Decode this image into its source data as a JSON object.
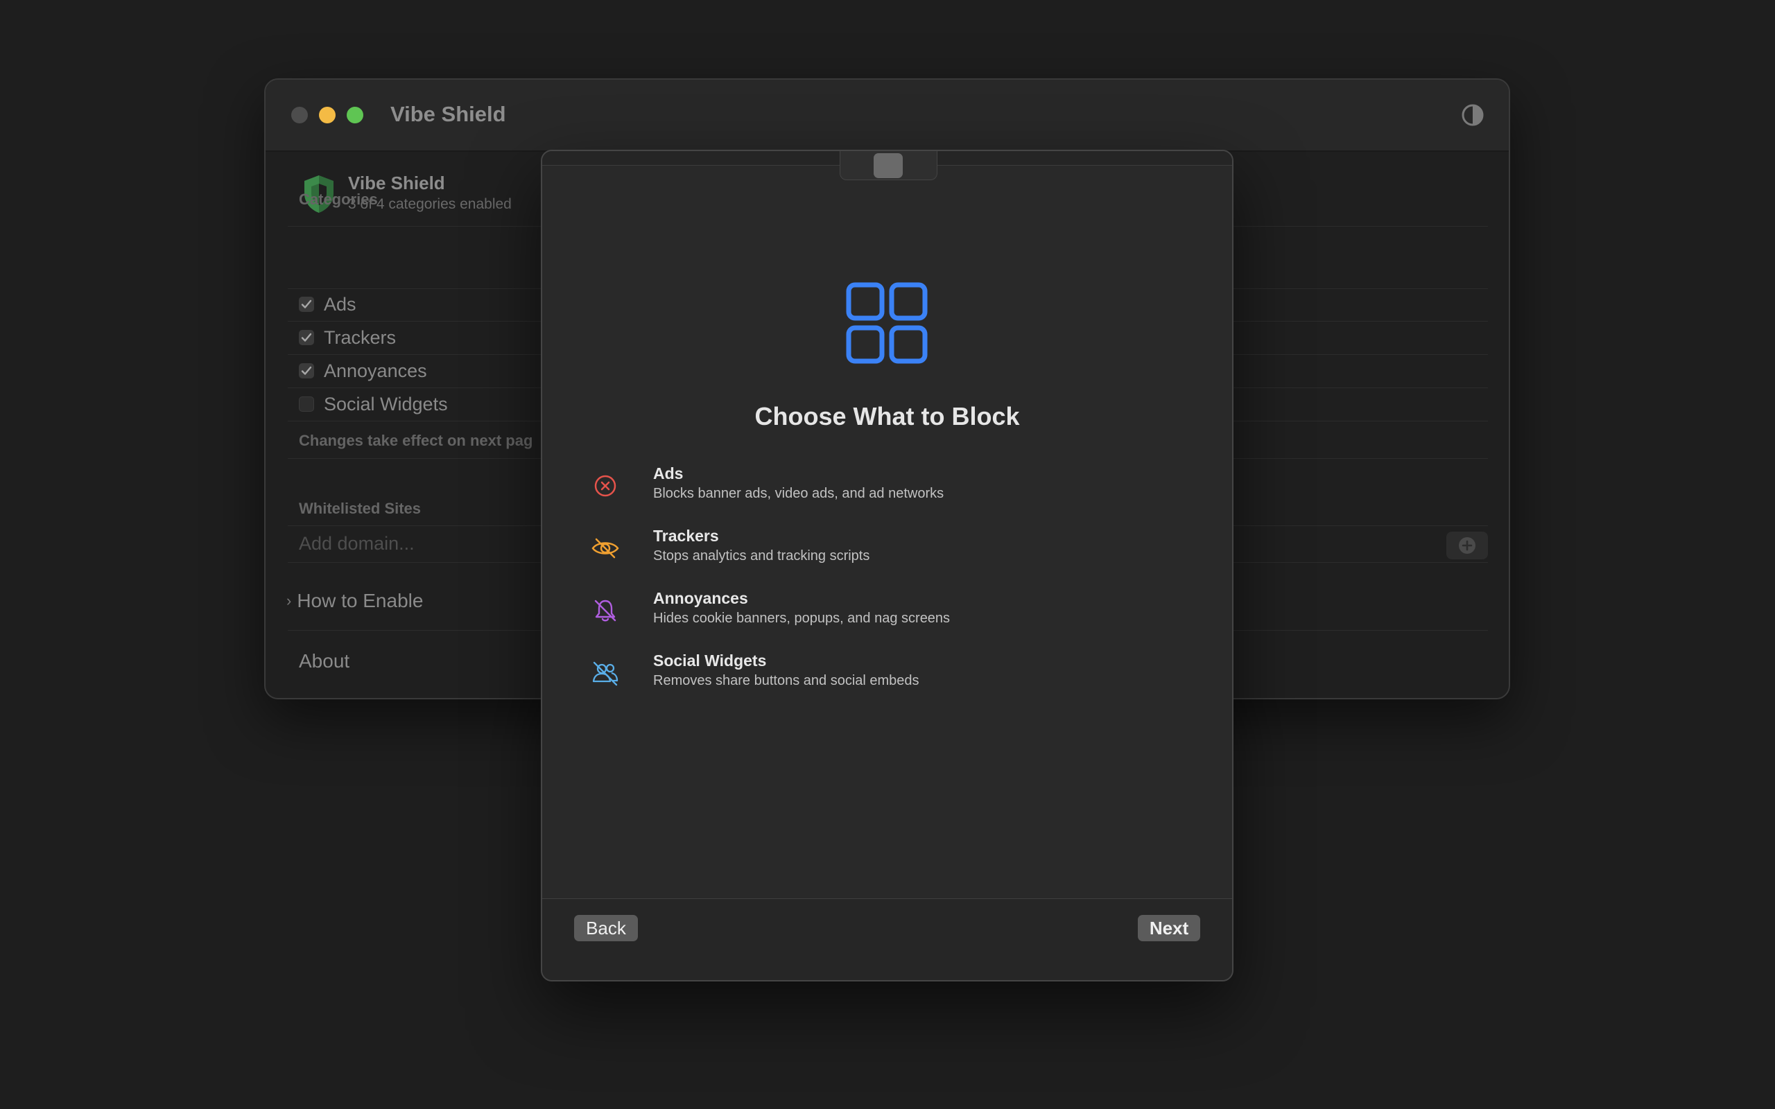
{
  "window": {
    "title": "Vibe Shield"
  },
  "header": {
    "title": "Vibe Shield",
    "subtitle": "3 of 4 categories enabled"
  },
  "categories": {
    "label": "Categories",
    "items": [
      {
        "label": "Ads",
        "checked": true
      },
      {
        "label": "Trackers",
        "checked": true
      },
      {
        "label": "Annoyances",
        "checked": true
      },
      {
        "label": "Social Widgets",
        "checked": false
      }
    ],
    "note": "Changes take effect on next pag"
  },
  "whitelist": {
    "label": "Whitelisted Sites",
    "placeholder": "Add domain..."
  },
  "how_to_enable": "How to Enable",
  "about": "About",
  "sheet": {
    "heading": "Choose What to Block",
    "items": [
      {
        "title": "Ads",
        "desc": "Blocks banner ads, video ads, and ad networks",
        "icon": "xmark-circle-icon",
        "color": "#e5534b"
      },
      {
        "title": "Trackers",
        "desc": "Stops analytics and tracking scripts",
        "icon": "eye-slash-icon",
        "color": "#f0a030"
      },
      {
        "title": "Annoyances",
        "desc": "Hides cookie banners, popups, and nag screens",
        "icon": "bell-slash-icon",
        "color": "#b05ee0"
      },
      {
        "title": "Social Widgets",
        "desc": "Removes share buttons and social embeds",
        "icon": "person-slash-icon",
        "color": "#5aaee8"
      }
    ],
    "back_label": "Back",
    "next_label": "Next"
  },
  "colors": {
    "accent": "#3b82f6",
    "shield": "#2f6b3a"
  }
}
